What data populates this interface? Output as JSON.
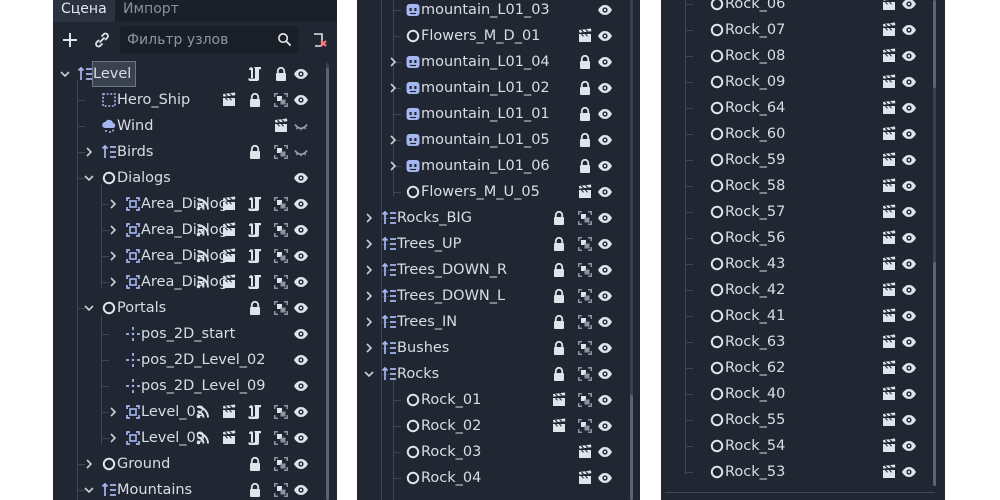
{
  "scene_panel": {
    "tabs": [
      "Сцена",
      "Импорт"
    ],
    "filter_placeholder": "Фильтр узлов",
    "nodes": [
      {
        "name": "Level",
        "icon": "node2d-icon",
        "arrow": "down",
        "selected": true,
        "ico": [
          "script-icon",
          "lock-icon",
          "eye-icon"
        ]
      },
      {
        "name": "Hero_Ship",
        "icon": "reference-rect-icon",
        "ico": [
          "scene-icon",
          "lock-icon",
          "group-icon",
          "eye-icon"
        ]
      },
      {
        "name": "Wind",
        "icon": "particles-icon",
        "ico": [
          "scene-icon",
          "eye-closed-icon"
        ]
      },
      {
        "name": "Birds",
        "icon": "node2d-icon",
        "arrow": "right",
        "ico": [
          "lock-icon",
          "group-icon",
          "eye-closed-icon"
        ]
      },
      {
        "name": "Dialogs",
        "icon": "circle-node-icon",
        "arrow": "down",
        "ico": [
          "eye-icon"
        ]
      },
      {
        "name": "Area_Dialog",
        "icon": "area2d-icon",
        "arrow": "right",
        "ico": [
          "signal-icon",
          "scene-icon",
          "script-icon",
          "group-icon",
          "eye-icon"
        ]
      },
      {
        "name": "Area_Dialog",
        "icon": "area2d-icon",
        "arrow": "right",
        "ico": [
          "signal-icon",
          "scene-icon",
          "script-icon",
          "group-icon",
          "eye-icon"
        ]
      },
      {
        "name": "Area_Dialog",
        "icon": "area2d-icon",
        "arrow": "right",
        "ico": [
          "signal-icon",
          "scene-icon",
          "script-icon",
          "group-icon",
          "eye-icon"
        ]
      },
      {
        "name": "Area_Dialog",
        "icon": "area2d-icon",
        "arrow": "right",
        "ico": [
          "signal-icon",
          "scene-icon",
          "script-icon",
          "group-icon",
          "eye-icon"
        ]
      },
      {
        "name": "Portals",
        "icon": "circle-node-icon",
        "arrow": "down",
        "ico": [
          "lock-icon",
          "group-icon",
          "eye-icon"
        ]
      },
      {
        "name": "pos_2D_start",
        "icon": "position2d-icon",
        "ico": [
          "eye-icon"
        ]
      },
      {
        "name": "pos_2D_Level_02",
        "icon": "position2d-icon",
        "ico": [
          "eye-icon"
        ]
      },
      {
        "name": "pos_2D_Level_09",
        "icon": "position2d-icon",
        "ico": [
          "eye-icon"
        ]
      },
      {
        "name": "Level_02",
        "icon": "area2d-icon",
        "arrow": "right",
        "ico": [
          "signal-icon",
          "scene-icon",
          "script-icon",
          "group-icon",
          "eye-icon"
        ]
      },
      {
        "name": "Level_09",
        "icon": "area2d-icon",
        "arrow": "right",
        "ico": [
          "signal-icon",
          "scene-icon",
          "script-icon",
          "group-icon",
          "eye-icon"
        ]
      },
      {
        "name": "Ground",
        "icon": "circle-node-icon",
        "arrow": "right",
        "ico": [
          "lock-icon",
          "group-icon",
          "eye-icon"
        ]
      },
      {
        "name": "Mountains",
        "icon": "node2d-icon",
        "arrow": "down",
        "ico": [
          "lock-icon",
          "group-icon",
          "eye-icon"
        ]
      }
    ]
  },
  "middle_panel": {
    "nodes": [
      {
        "name": "mountain_L01_03",
        "icon": "sprite-icon",
        "ico": [
          "eye-icon"
        ]
      },
      {
        "name": "Flowers_M_D_01",
        "icon": "circle-node-icon",
        "ico": [
          "scene-icon",
          "eye-icon"
        ]
      },
      {
        "name": "mountain_L01_04",
        "icon": "sprite-icon",
        "arrow": "right",
        "ico": [
          "lock-icon",
          "eye-icon"
        ]
      },
      {
        "name": "mountain_L01_02",
        "icon": "sprite-icon",
        "arrow": "right",
        "ico": [
          "lock-icon",
          "eye-icon"
        ]
      },
      {
        "name": "mountain_L01_01",
        "icon": "sprite-icon",
        "ico": [
          "lock-icon",
          "eye-icon"
        ]
      },
      {
        "name": "mountain_L01_05",
        "icon": "sprite-icon",
        "arrow": "right",
        "ico": [
          "lock-icon",
          "eye-icon"
        ]
      },
      {
        "name": "mountain_L01_06",
        "icon": "sprite-icon",
        "arrow": "right",
        "ico": [
          "lock-icon",
          "eye-icon"
        ]
      },
      {
        "name": "Flowers_M_U_05",
        "icon": "circle-node-icon",
        "ico": [
          "scene-icon",
          "eye-icon"
        ]
      },
      {
        "name": "Rocks_BIG",
        "icon": "node2d-icon",
        "arrow": "right",
        "ico": [
          "lock-icon",
          "group-icon",
          "eye-icon"
        ]
      },
      {
        "name": "Trees_UP",
        "icon": "node2d-icon",
        "arrow": "right",
        "ico": [
          "lock-icon",
          "group-icon",
          "eye-icon"
        ]
      },
      {
        "name": "Trees_DOWN_R",
        "icon": "node2d-icon",
        "arrow": "right",
        "ico": [
          "lock-icon",
          "group-icon",
          "eye-icon"
        ]
      },
      {
        "name": "Trees_DOWN_L",
        "icon": "node2d-icon",
        "arrow": "right",
        "ico": [
          "lock-icon",
          "group-icon",
          "eye-icon"
        ]
      },
      {
        "name": "Trees_IN",
        "icon": "node2d-icon",
        "arrow": "right",
        "ico": [
          "lock-icon",
          "group-icon",
          "eye-icon"
        ]
      },
      {
        "name": "Bushes",
        "icon": "node2d-icon",
        "arrow": "right",
        "ico": [
          "lock-icon",
          "group-icon",
          "eye-icon"
        ]
      },
      {
        "name": "Rocks",
        "icon": "node2d-icon",
        "arrow": "down",
        "ico": [
          "lock-icon",
          "group-icon",
          "eye-icon"
        ]
      },
      {
        "name": "Rock_01",
        "icon": "circle-node-icon",
        "ico": [
          "scene-icon",
          "group-icon",
          "eye-icon"
        ]
      },
      {
        "name": "Rock_02",
        "icon": "circle-node-icon",
        "ico": [
          "scene-icon",
          "group-icon",
          "eye-icon"
        ]
      },
      {
        "name": "Rock_03",
        "icon": "circle-node-icon",
        "ico": [
          "scene-icon",
          "eye-icon"
        ]
      },
      {
        "name": "Rock_04",
        "icon": "circle-node-icon",
        "ico": [
          "scene-icon",
          "eye-icon"
        ]
      }
    ]
  },
  "right_panel": {
    "nodes": [
      "Rock_06",
      "Rock_07",
      "Rock_08",
      "Rock_09",
      "Rock_64",
      "Rock_60",
      "Rock_59",
      "Rock_58",
      "Rock_57",
      "Rock_56",
      "Rock_43",
      "Rock_42",
      "Rock_41",
      "Rock_63",
      "Rock_62",
      "Rock_40",
      "Rock_55",
      "Rock_54",
      "Rock_53"
    ],
    "node_icon": "circle-node-icon",
    "ico": [
      "scene-icon",
      "eye-icon"
    ]
  },
  "colors": {
    "panel_bg": "#212732",
    "tab_bar_bg": "#1b1f28",
    "node_icon_blue": "#a5b7f3",
    "icon_light": "#dfe3ea",
    "tree_line": "#3f4756",
    "selection_bg": "#3a424f"
  }
}
